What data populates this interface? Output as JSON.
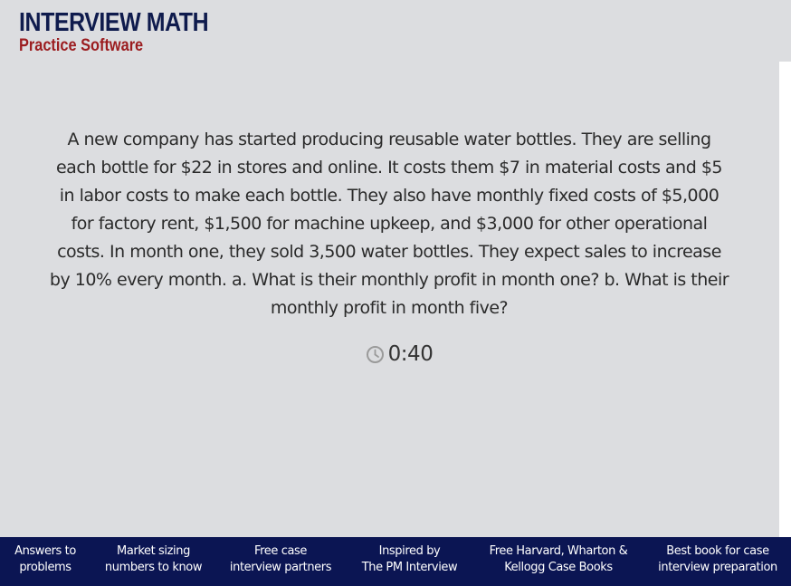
{
  "header": {
    "title": "INTERVIEW MATH",
    "subtitle": "Practice Software"
  },
  "main": {
    "question": "A new company has started producing reusable water bottles. They are selling each bottle for $22 in stores and online. It costs them $7 in material costs and $5 in labor costs to make each bottle. They also have monthly fixed costs of $5,000 for factory rent, $1,500 for machine upkeep, and $3,000 for other operational costs. In month one, they sold 3,500 water bottles. They expect sales to increase by 10% every month. a. What is their monthly profit in month one? b. What is their monthly profit in month five?",
    "timer": "0:40",
    "timer_icon": "clock-icon"
  },
  "footer": {
    "links": [
      {
        "line1": "Answers to",
        "line2": "problems"
      },
      {
        "line1": "Market sizing",
        "line2": "numbers to know"
      },
      {
        "line1": "Free case",
        "line2": "interview partners"
      },
      {
        "line1": "Inspired by",
        "line2": "The PM Interview"
      },
      {
        "line1": "Free Harvard, Wharton &",
        "line2": "Kellogg Case Books"
      },
      {
        "line1": "Best book for case",
        "line2": "interview preparation"
      }
    ]
  },
  "colors": {
    "background": "#dcdde0",
    "title": "#0f1b4d",
    "subtitle": "#9b1c1f",
    "footer": "#0b1553"
  }
}
